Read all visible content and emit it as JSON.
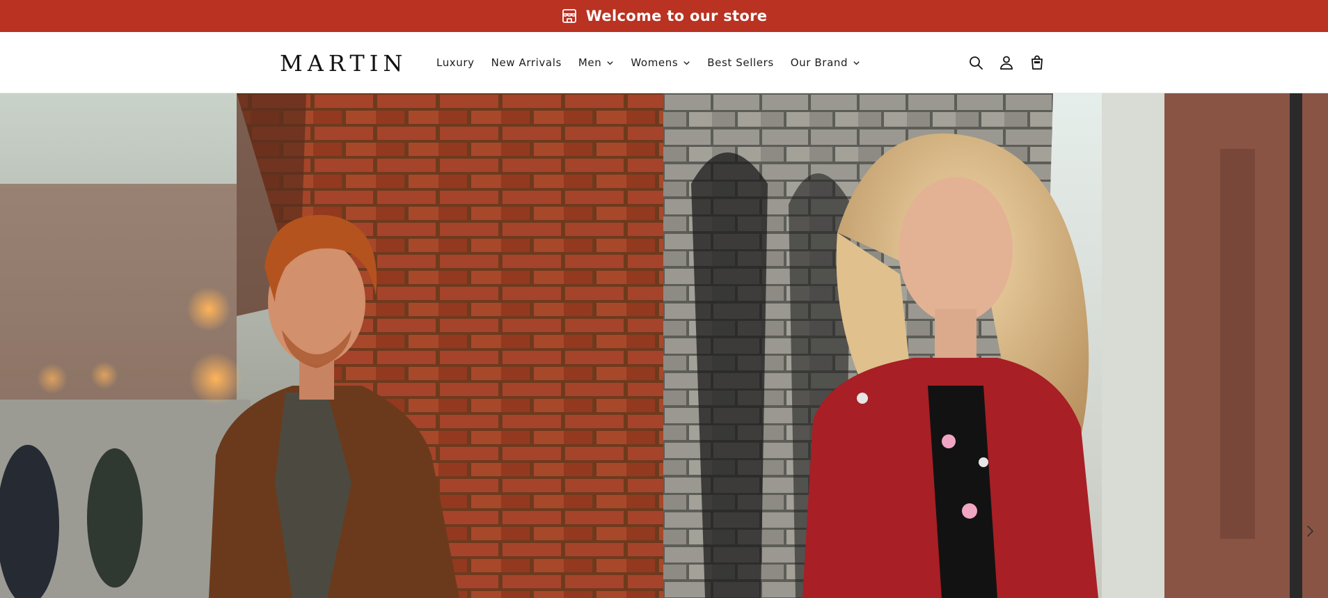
{
  "announcement": {
    "icon": "storefront-icon",
    "text": "Welcome to our store",
    "background": "#b93222"
  },
  "header": {
    "logo": "MARTIN",
    "nav": [
      {
        "label": "Luxury",
        "dropdown": false
      },
      {
        "label": "New Arrivals",
        "dropdown": false
      },
      {
        "label": "Men",
        "dropdown": true
      },
      {
        "label": "Womens",
        "dropdown": true
      },
      {
        "label": "Best Sellers",
        "dropdown": false
      },
      {
        "label": "Our Brand",
        "dropdown": true
      }
    ],
    "icons": [
      "search-icon",
      "account-icon",
      "cart-icon"
    ]
  },
  "hero": {
    "slides": [
      {
        "image": "man-brown-leather-jacket-photo"
      },
      {
        "image": "woman-red-leather-jacket-photo"
      }
    ],
    "next_icon": "chevron-right-icon"
  }
}
